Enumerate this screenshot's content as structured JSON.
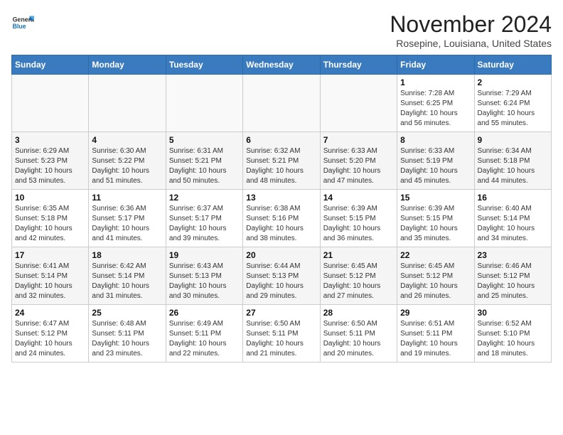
{
  "header": {
    "logo_line1": "General",
    "logo_line2": "Blue",
    "month": "November 2024",
    "location": "Rosepine, Louisiana, United States"
  },
  "days_of_week": [
    "Sunday",
    "Monday",
    "Tuesday",
    "Wednesday",
    "Thursday",
    "Friday",
    "Saturday"
  ],
  "weeks": [
    [
      {
        "day": "",
        "info": ""
      },
      {
        "day": "",
        "info": ""
      },
      {
        "day": "",
        "info": ""
      },
      {
        "day": "",
        "info": ""
      },
      {
        "day": "",
        "info": ""
      },
      {
        "day": "1",
        "info": "Sunrise: 7:28 AM\nSunset: 6:25 PM\nDaylight: 10 hours and 56 minutes."
      },
      {
        "day": "2",
        "info": "Sunrise: 7:29 AM\nSunset: 6:24 PM\nDaylight: 10 hours and 55 minutes."
      }
    ],
    [
      {
        "day": "3",
        "info": "Sunrise: 6:29 AM\nSunset: 5:23 PM\nDaylight: 10 hours and 53 minutes."
      },
      {
        "day": "4",
        "info": "Sunrise: 6:30 AM\nSunset: 5:22 PM\nDaylight: 10 hours and 51 minutes."
      },
      {
        "day": "5",
        "info": "Sunrise: 6:31 AM\nSunset: 5:21 PM\nDaylight: 10 hours and 50 minutes."
      },
      {
        "day": "6",
        "info": "Sunrise: 6:32 AM\nSunset: 5:21 PM\nDaylight: 10 hours and 48 minutes."
      },
      {
        "day": "7",
        "info": "Sunrise: 6:33 AM\nSunset: 5:20 PM\nDaylight: 10 hours and 47 minutes."
      },
      {
        "day": "8",
        "info": "Sunrise: 6:33 AM\nSunset: 5:19 PM\nDaylight: 10 hours and 45 minutes."
      },
      {
        "day": "9",
        "info": "Sunrise: 6:34 AM\nSunset: 5:18 PM\nDaylight: 10 hours and 44 minutes."
      }
    ],
    [
      {
        "day": "10",
        "info": "Sunrise: 6:35 AM\nSunset: 5:18 PM\nDaylight: 10 hours and 42 minutes."
      },
      {
        "day": "11",
        "info": "Sunrise: 6:36 AM\nSunset: 5:17 PM\nDaylight: 10 hours and 41 minutes."
      },
      {
        "day": "12",
        "info": "Sunrise: 6:37 AM\nSunset: 5:17 PM\nDaylight: 10 hours and 39 minutes."
      },
      {
        "day": "13",
        "info": "Sunrise: 6:38 AM\nSunset: 5:16 PM\nDaylight: 10 hours and 38 minutes."
      },
      {
        "day": "14",
        "info": "Sunrise: 6:39 AM\nSunset: 5:15 PM\nDaylight: 10 hours and 36 minutes."
      },
      {
        "day": "15",
        "info": "Sunrise: 6:39 AM\nSunset: 5:15 PM\nDaylight: 10 hours and 35 minutes."
      },
      {
        "day": "16",
        "info": "Sunrise: 6:40 AM\nSunset: 5:14 PM\nDaylight: 10 hours and 34 minutes."
      }
    ],
    [
      {
        "day": "17",
        "info": "Sunrise: 6:41 AM\nSunset: 5:14 PM\nDaylight: 10 hours and 32 minutes."
      },
      {
        "day": "18",
        "info": "Sunrise: 6:42 AM\nSunset: 5:14 PM\nDaylight: 10 hours and 31 minutes."
      },
      {
        "day": "19",
        "info": "Sunrise: 6:43 AM\nSunset: 5:13 PM\nDaylight: 10 hours and 30 minutes."
      },
      {
        "day": "20",
        "info": "Sunrise: 6:44 AM\nSunset: 5:13 PM\nDaylight: 10 hours and 29 minutes."
      },
      {
        "day": "21",
        "info": "Sunrise: 6:45 AM\nSunset: 5:12 PM\nDaylight: 10 hours and 27 minutes."
      },
      {
        "day": "22",
        "info": "Sunrise: 6:45 AM\nSunset: 5:12 PM\nDaylight: 10 hours and 26 minutes."
      },
      {
        "day": "23",
        "info": "Sunrise: 6:46 AM\nSunset: 5:12 PM\nDaylight: 10 hours and 25 minutes."
      }
    ],
    [
      {
        "day": "24",
        "info": "Sunrise: 6:47 AM\nSunset: 5:12 PM\nDaylight: 10 hours and 24 minutes."
      },
      {
        "day": "25",
        "info": "Sunrise: 6:48 AM\nSunset: 5:11 PM\nDaylight: 10 hours and 23 minutes."
      },
      {
        "day": "26",
        "info": "Sunrise: 6:49 AM\nSunset: 5:11 PM\nDaylight: 10 hours and 22 minutes."
      },
      {
        "day": "27",
        "info": "Sunrise: 6:50 AM\nSunset: 5:11 PM\nDaylight: 10 hours and 21 minutes."
      },
      {
        "day": "28",
        "info": "Sunrise: 6:50 AM\nSunset: 5:11 PM\nDaylight: 10 hours and 20 minutes."
      },
      {
        "day": "29",
        "info": "Sunrise: 6:51 AM\nSunset: 5:11 PM\nDaylight: 10 hours and 19 minutes."
      },
      {
        "day": "30",
        "info": "Sunrise: 6:52 AM\nSunset: 5:10 PM\nDaylight: 10 hours and 18 minutes."
      }
    ]
  ]
}
